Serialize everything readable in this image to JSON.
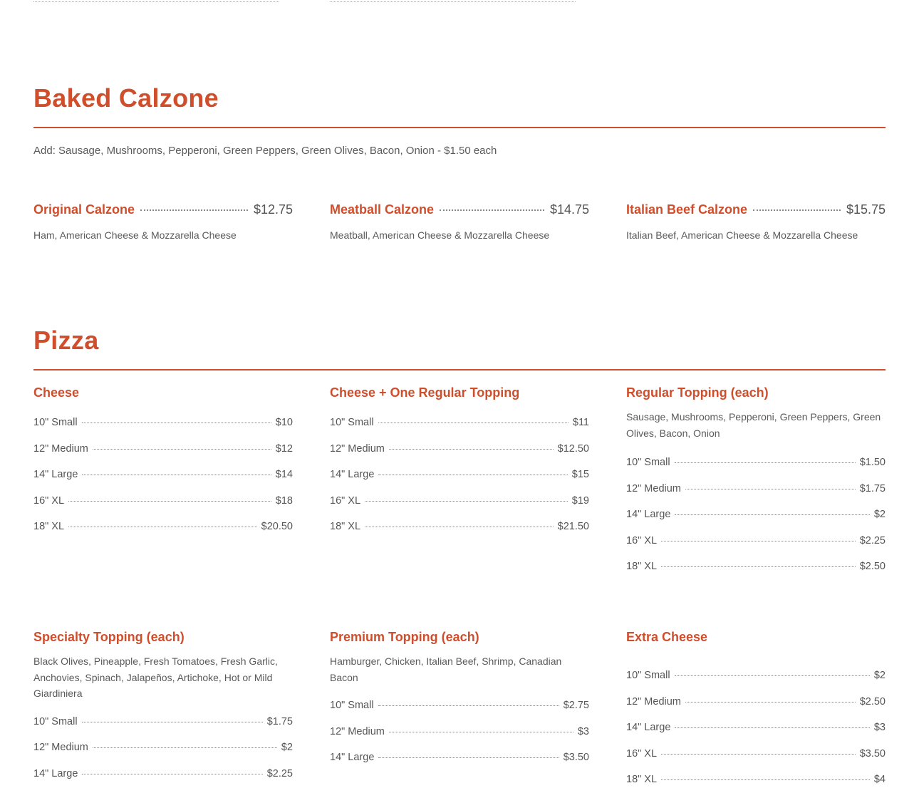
{
  "calzone": {
    "title": "Baked Calzone",
    "note": "Add: Sausage, Mushrooms, Pepperoni, Green Peppers, Green Olives, Bacon, Onion - $1.50 each",
    "items": [
      {
        "name": "Original Calzone",
        "price": "$12.75",
        "desc": "Ham, American Cheese & Mozzarella Cheese"
      },
      {
        "name": "Meatball Calzone",
        "price": "$14.75",
        "desc": "Meatball, American Cheese & Mozzarella Cheese"
      },
      {
        "name": "Italian Beef Calzone",
        "price": "$15.75",
        "desc": "Italian Beef, American Cheese & Mozzarella Cheese"
      }
    ]
  },
  "pizza": {
    "title": "Pizza",
    "groups": [
      {
        "title": "Cheese",
        "desc": "",
        "rows": [
          {
            "size": "10\" Small",
            "price": "$10"
          },
          {
            "size": "12\" Medium",
            "price": "$12"
          },
          {
            "size": "14\" Large",
            "price": "$14"
          },
          {
            "size": "16\" XL",
            "price": "$18"
          },
          {
            "size": "18\" XL",
            "price": "$20.50"
          }
        ]
      },
      {
        "title": "Cheese + One Regular Topping",
        "desc": "",
        "rows": [
          {
            "size": "10\" Small",
            "price": "$11"
          },
          {
            "size": "12\" Medium",
            "price": "$12.50"
          },
          {
            "size": "14\" Large",
            "price": "$15"
          },
          {
            "size": "16\" XL",
            "price": "$19"
          },
          {
            "size": "18\" XL",
            "price": "$21.50"
          }
        ]
      },
      {
        "title": "Regular Topping (each)",
        "desc": "Sausage, Mushrooms, Pepperoni, Green Peppers, Green Olives, Bacon, Onion",
        "rows": [
          {
            "size": "10\" Small",
            "price": "$1.50"
          },
          {
            "size": "12\" Medium",
            "price": "$1.75"
          },
          {
            "size": "14\" Large",
            "price": "$2"
          },
          {
            "size": "16\" XL",
            "price": "$2.25"
          },
          {
            "size": "18\" XL",
            "price": "$2.50"
          }
        ]
      },
      {
        "title": "Specialty Topping (each)",
        "desc": "Black Olives, Pineapple, Fresh Tomatoes, Fresh Garlic, Anchovies, Spinach, Jalapeños, Artichoke, Hot or Mild Giardiniera",
        "rows": [
          {
            "size": "10\" Small",
            "price": "$1.75"
          },
          {
            "size": "12\" Medium",
            "price": "$2"
          },
          {
            "size": "14\" Large",
            "price": "$2.25"
          }
        ]
      },
      {
        "title": "Premium Topping (each)",
        "desc": "Hamburger, Chicken, Italian Beef, Shrimp, Canadian Bacon",
        "rows": [
          {
            "size": "10\" Small",
            "price": "$2.75"
          },
          {
            "size": "12\" Medium",
            "price": "$3"
          },
          {
            "size": "14\" Large",
            "price": "$3.50"
          }
        ]
      },
      {
        "title": "Extra Cheese",
        "desc": "",
        "rows": [
          {
            "size": "10\" Small",
            "price": "$2"
          },
          {
            "size": "12\" Medium",
            "price": "$2.50"
          },
          {
            "size": "14\" Large",
            "price": "$3"
          },
          {
            "size": "16\" XL",
            "price": "$3.50"
          },
          {
            "size": "18\" XL",
            "price": "$4"
          }
        ]
      }
    ]
  }
}
